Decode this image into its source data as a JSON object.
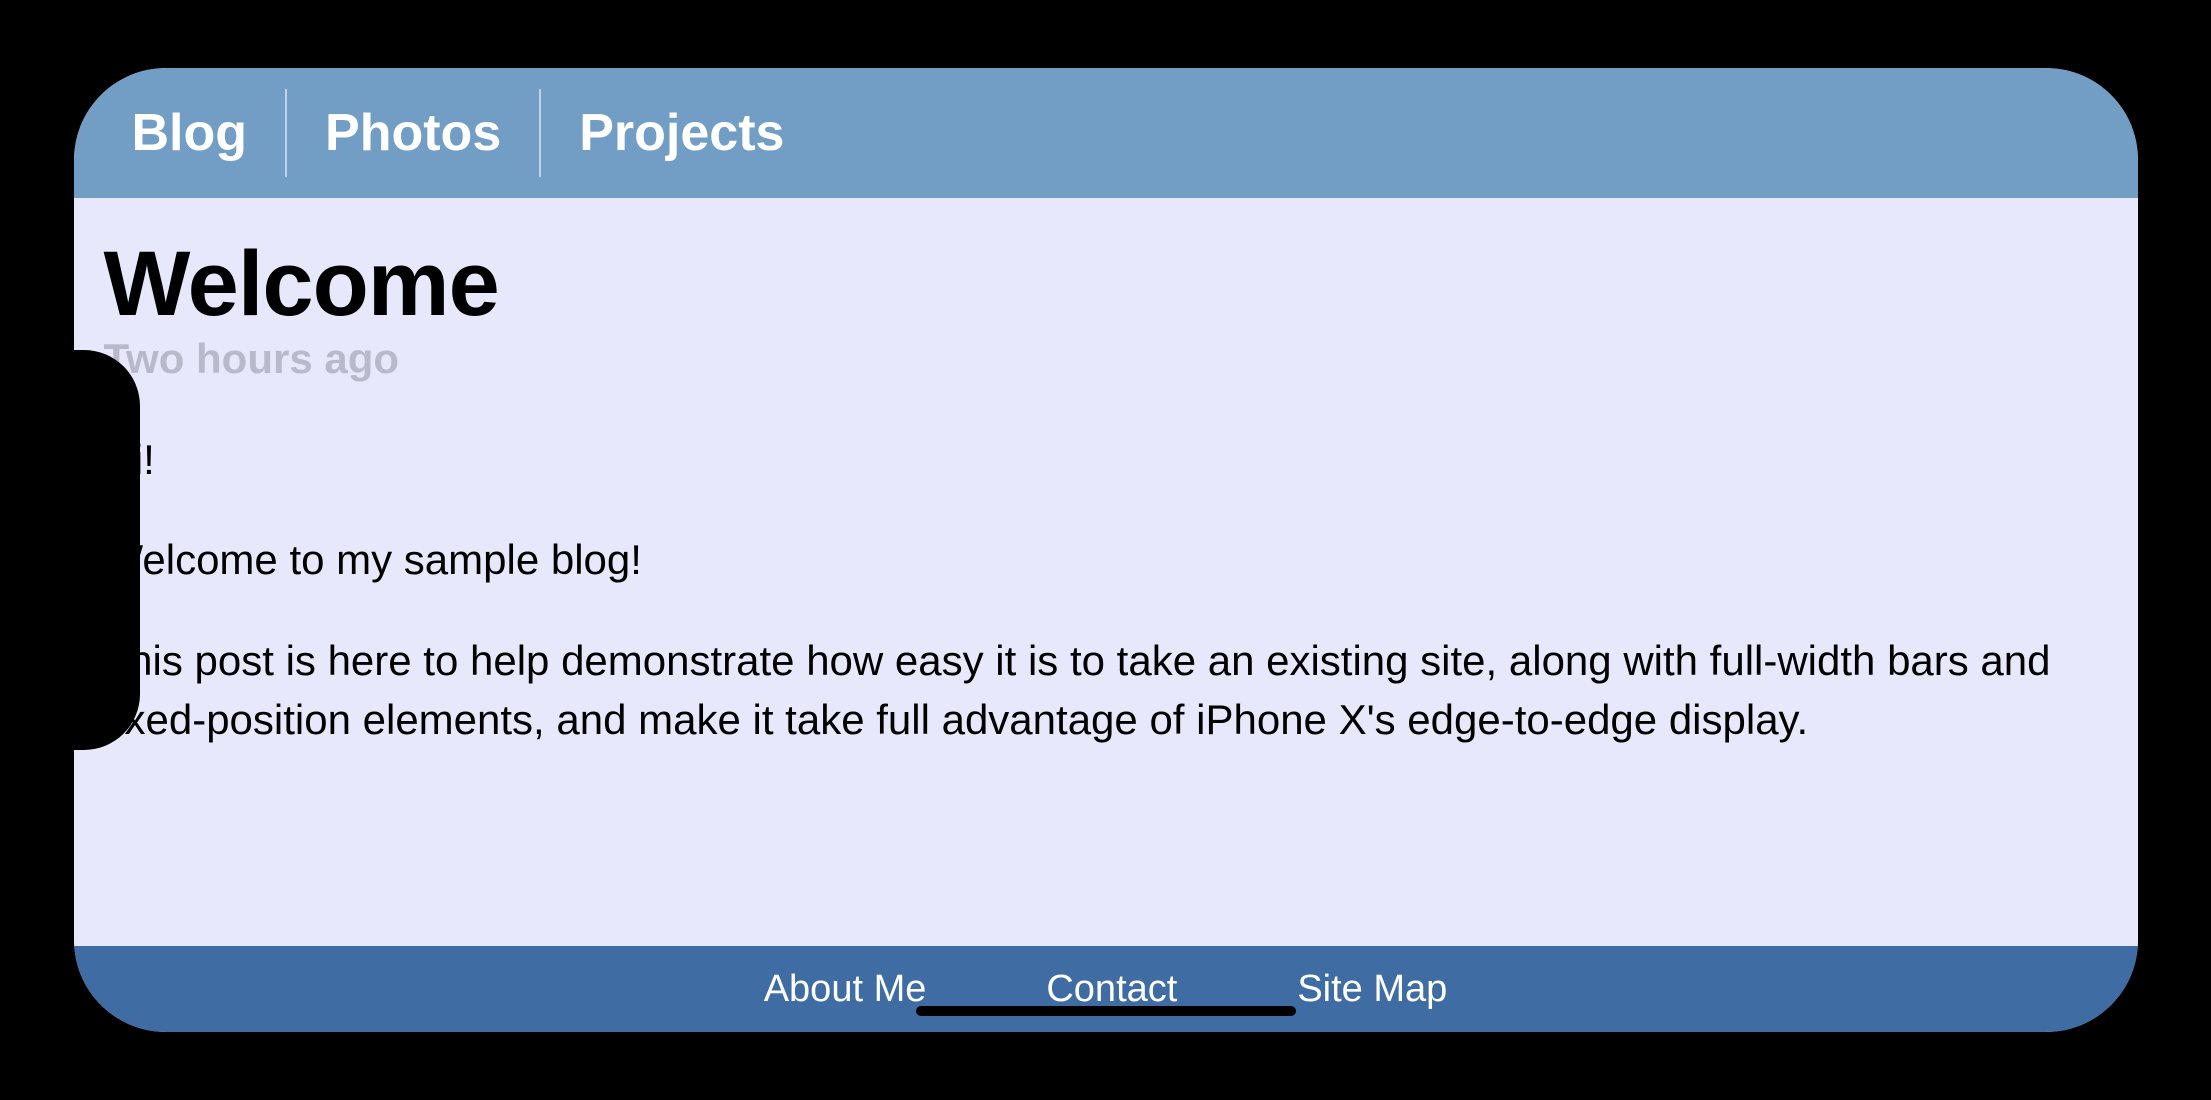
{
  "nav": {
    "tabs": [
      {
        "label": "Blog"
      },
      {
        "label": "Photos"
      },
      {
        "label": "Projects"
      }
    ]
  },
  "post": {
    "title": "Welcome",
    "timestamp": "Two hours ago",
    "paragraphs": [
      "Hi!",
      "Welcome to my sample blog!",
      "This post is here to help demonstrate how easy it is to take an existing site, along with full-width bars and fixed-position elements, and make it take full advantage of iPhone X's edge-to-edge display."
    ]
  },
  "footer": {
    "links": [
      {
        "label": "About Me"
      },
      {
        "label": "Contact"
      },
      {
        "label": "Site Map"
      }
    ]
  }
}
